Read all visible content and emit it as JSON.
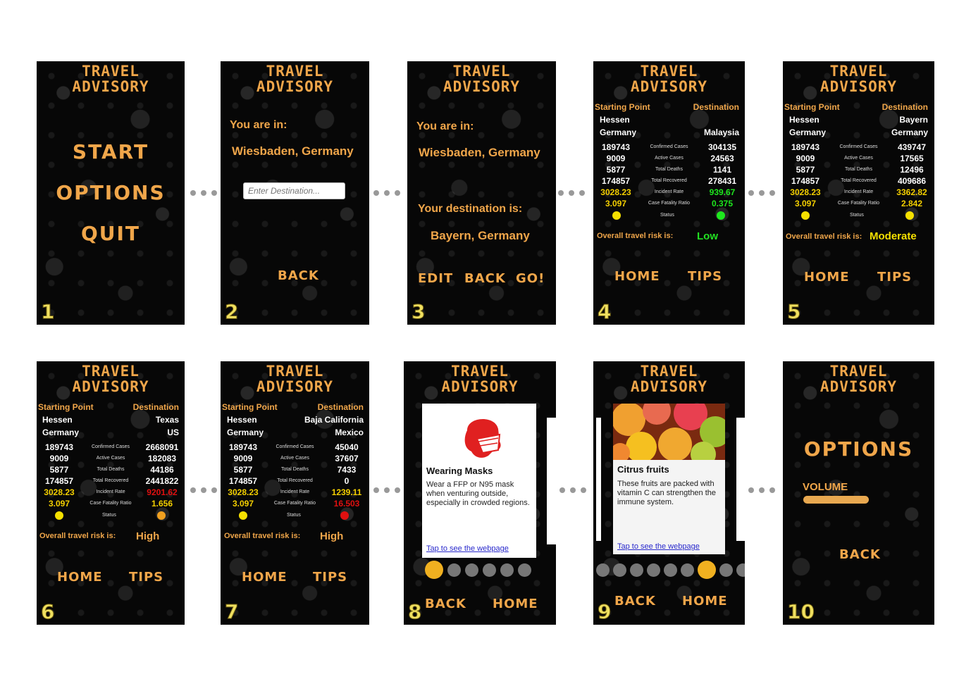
{
  "title": {
    "line1": "TRAVEL",
    "line2": "ADVISORY"
  },
  "separator": "• • •",
  "screens": {
    "s1": {
      "number": "1",
      "start": "START",
      "options": "OPTIONS",
      "quit": "QUIT"
    },
    "s2": {
      "number": "2",
      "you_are_in": "You are in:",
      "location": "Wiesbaden, Germany",
      "placeholder": "Enter Destination...",
      "back": "BACK"
    },
    "s3": {
      "number": "3",
      "you_are_in": "You are in:",
      "location": "Wiesbaden, Germany",
      "dest_label": "Your destination is:",
      "destination": "Bayern, Germany",
      "edit": "EDIT",
      "back": "BACK",
      "go": "GO!"
    },
    "s4": {
      "number": "4",
      "start_hdr": "Starting Point",
      "dest_hdr": "Destination",
      "left_region": "Hessen",
      "left_country": "Germany",
      "right_region": "",
      "right_country": "Malaysia",
      "left": [
        "189743",
        "9009",
        "5877",
        "174857",
        "3028.23",
        "3.097"
      ],
      "right": [
        "304135",
        "24563",
        "1141",
        "278431",
        "939.67",
        "0.375"
      ],
      "status_left": "#f5e000",
      "status_right": "#1ee81e",
      "risk_label": "Overall travel risk is:",
      "risk": "Low",
      "risk_color": "#22e022",
      "home": "HOME",
      "tips": "TIPS"
    },
    "s5": {
      "number": "5",
      "start_hdr": "Starting Point",
      "dest_hdr": "Destination",
      "left_region": "Hessen",
      "left_country": "Germany",
      "right_region": "Bayern",
      "right_country": "Germany",
      "left": [
        "189743",
        "9009",
        "5877",
        "174857",
        "3028.23",
        "3.097"
      ],
      "right": [
        "439747",
        "17565",
        "12496",
        "409686",
        "3362.82",
        "2.842"
      ],
      "status_left": "#f5e000",
      "status_right": "#f5e000",
      "risk_label": "Overall travel risk is:",
      "risk": "Moderate",
      "risk_color": "#f5e000",
      "home": "HOME",
      "tips": "TIPS"
    },
    "s6": {
      "number": "6",
      "start_hdr": "Starting Point",
      "dest_hdr": "Destination",
      "left_region": "Hessen",
      "left_country": "Germany",
      "right_region": "Texas",
      "right_country": "US",
      "left": [
        "189743",
        "9009",
        "5877",
        "174857",
        "3028.23",
        "3.097"
      ],
      "right": [
        "2668091",
        "182083",
        "44186",
        "2441822",
        "9201.62",
        "1.656"
      ],
      "status_left": "#f5e000",
      "status_right": "#f0a020",
      "risk_label": "Overall travel risk is:",
      "risk": "High",
      "risk_color": "#f0a64a",
      "home": "HOME",
      "tips": "TIPS"
    },
    "s7": {
      "number": "7",
      "start_hdr": "Starting Point",
      "dest_hdr": "Destination",
      "left_region": "Hessen",
      "left_country": "Germany",
      "right_region": "Baja California",
      "right_country": "Mexico",
      "left": [
        "189743",
        "9009",
        "5877",
        "174857",
        "3028.23",
        "3.097"
      ],
      "right": [
        "45040",
        "37607",
        "7433",
        "0",
        "1239.11",
        "16.503"
      ],
      "status_left": "#f5e000",
      "status_right": "#e01010",
      "risk_label": "Overall travel risk is:",
      "risk": "High",
      "risk_color": "#f0a64a",
      "home": "HOME",
      "tips": "TIPS"
    },
    "s8": {
      "number": "8",
      "card_title": "Wearing Masks",
      "card_body": "Wear a FFP or N95 mask when venturing outside, especially in crowded regions.",
      "card_link": "Tap to see the webpage",
      "back": "BACK",
      "home": "HOME"
    },
    "s9": {
      "number": "9",
      "card_title": "Citrus fruits",
      "card_body": "These fruits are packed with vitamin C can strengthen the immune system.",
      "card_link": "Tap to see the webpage",
      "back": "BACK",
      "home": "HOME"
    },
    "s10": {
      "number": "10",
      "heading": "OPTIONS",
      "volume": "VOLUME",
      "back": "BACK"
    }
  },
  "row_labels": [
    "Confirmed Cases",
    "Active Cases",
    "Total Deaths",
    "Total Recovered",
    "Incident Rate",
    "Case Fatality Ratio"
  ],
  "status_label": "Status"
}
